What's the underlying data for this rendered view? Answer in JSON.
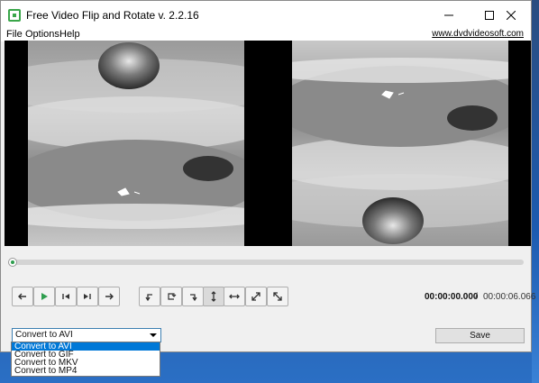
{
  "window": {
    "title": "Free Video Flip and Rotate v. 2.2.16",
    "minimize_icon": "minimize-icon",
    "maximize_icon": "maximize-icon",
    "close_icon": "close-icon"
  },
  "menu": {
    "file": "File",
    "options": "Options",
    "help": "Help",
    "website": "www.dvdvideosoft.com"
  },
  "player": {
    "seek_value": 0,
    "time_current": "00:00:00.000",
    "time_separator": "/",
    "time_total": "00:00:06.066"
  },
  "controls": {
    "playback": [
      {
        "name": "prev-frame-button",
        "icon": "arrow-left-icon"
      },
      {
        "name": "play-button",
        "icon": "play-icon"
      },
      {
        "name": "skip-start-button",
        "icon": "skip-back-icon"
      },
      {
        "name": "skip-end-button",
        "icon": "skip-forward-icon"
      },
      {
        "name": "next-frame-button",
        "icon": "arrow-right-icon"
      }
    ],
    "transform": [
      {
        "name": "rotate-left-button",
        "icon": "rotate-ccw-icon"
      },
      {
        "name": "rotate-180-button",
        "icon": "rotate-180-icon"
      },
      {
        "name": "rotate-right-button",
        "icon": "rotate-cw-icon"
      },
      {
        "name": "flip-vertical-button",
        "icon": "flip-vertical-icon",
        "active": true
      },
      {
        "name": "flip-horizontal-button",
        "icon": "flip-horizontal-icon"
      },
      {
        "name": "transpose-button",
        "icon": "diagonal-arrow-icon"
      },
      {
        "name": "transverse-button",
        "icon": "diagonal-arrow-reverse-icon"
      }
    ]
  },
  "output": {
    "selected_format": "Convert to AVI",
    "options": [
      "Convert to AVI",
      "Convert to GIF",
      "Convert to MKV",
      "Convert to MP4"
    ],
    "save_label": "Save"
  },
  "colors": {
    "accent_green": "#2e9e4e",
    "selection_blue": "#0078d7"
  }
}
